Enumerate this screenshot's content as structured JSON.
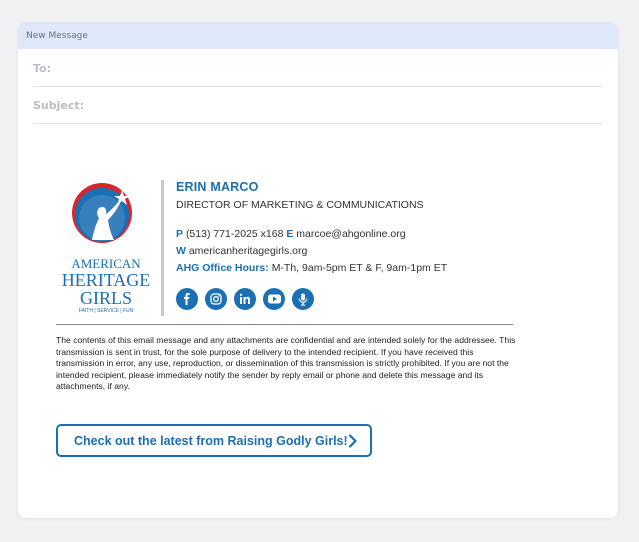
{
  "window": {
    "title": "New Message"
  },
  "fields": {
    "to_label": "To:",
    "subject_label": "Subject:"
  },
  "signature": {
    "name": "ERIN MARCO",
    "title": "DIRECTOR OF MARKETING & COMMUNICATIONS",
    "phone_label": "P",
    "phone": "(513) 771-2025 x168",
    "email_label": "E",
    "email": "marcoe@ahgonline.org",
    "web_label": "W",
    "website": "americanheritagegirls.org",
    "hours_label": "AHG Office Hours:",
    "hours": "M-Th, 9am-5pm ET & F, 9am-1pm ET",
    "logo": {
      "line1": "AMERICAN",
      "line2": "HERITAGE",
      "line3": "GIRLS",
      "tagline": "FAITH | SERVICE | FUN"
    },
    "socials": [
      "facebook-icon",
      "instagram-icon",
      "linkedin-icon",
      "youtube-icon",
      "podcast-icon"
    ]
  },
  "disclaimer": "The contents of this email message and any attachments are confidential and are intended solely for the addressee. This transmission is sent in trust, for the sole purpose of delivery to the intended recipient. If you have received this transmission in error, any use, reproduction, or dissemination of this transmission is strictly prohibited. If you are not the intended recipient, please immediately notify the sender by reply email or phone and delete this message and its attachments, if any.",
  "cta": {
    "label": "Check out the latest from Raising Godly Girls!"
  },
  "colors": {
    "accent": "#1b6fb5",
    "logo_red": "#d8262e",
    "titlebar": "#dfe8fb"
  }
}
